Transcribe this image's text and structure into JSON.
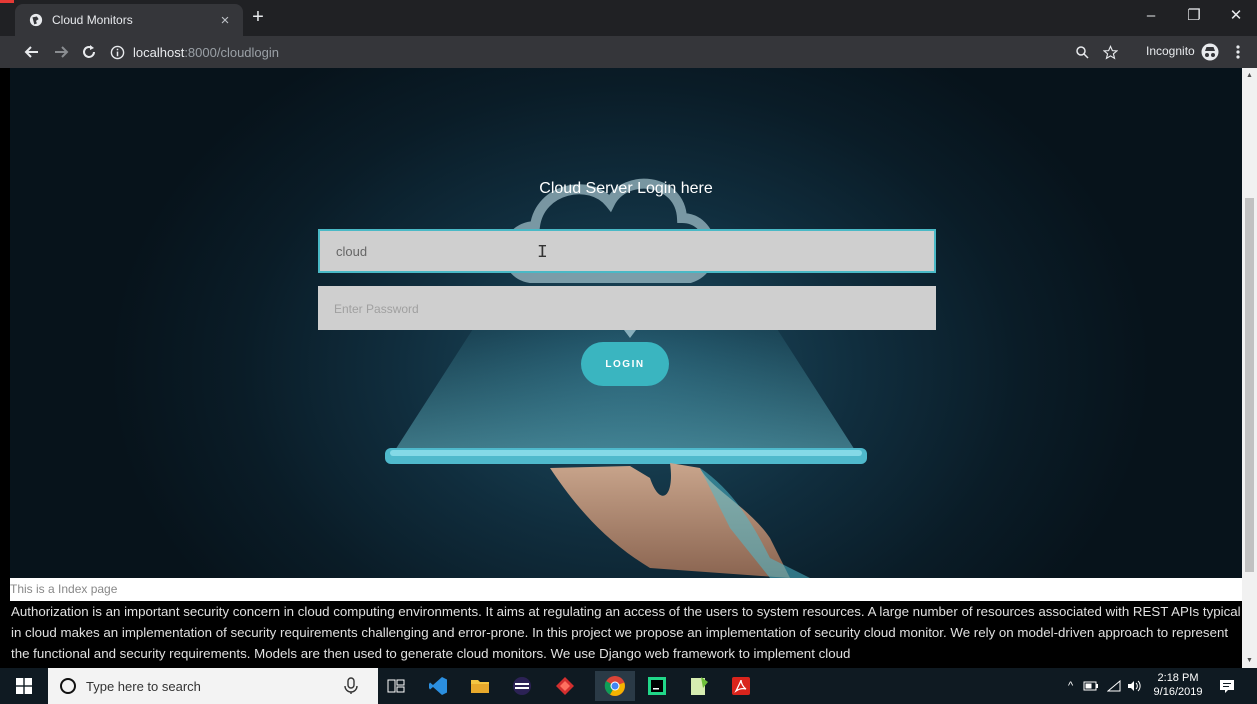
{
  "browser": {
    "tab_title": "Cloud Monitors",
    "tab_close": "×",
    "new_tab": "+",
    "url_host": "localhost",
    "url_path": ":8000/cloudlogin",
    "incognito_label": "Incognito",
    "win_minimize": "–",
    "win_restore": "❐",
    "win_close": "✕"
  },
  "login": {
    "title": "Cloud Server Login here",
    "username_value": "cloud",
    "password_placeholder": "Enter Password",
    "button_label": "LOGIN"
  },
  "page": {
    "index_note": "This is a Index page",
    "description": "Authorization is an important security concern in cloud computing environments. It aims at regulating an access of the users to system resources. A large number of resources associated with REST APIs typical in cloud makes an implementation of security requirements challenging and error-prone. In this project we propose an implementation of security cloud monitor. We rely on model-driven approach to represent the functional and security requirements. Models are then used to generate cloud monitors. We use Django web framework to implement cloud"
  },
  "taskbar": {
    "search_placeholder": "Type here to search",
    "time": "2:18 PM",
    "date": "9/16/2019"
  },
  "colors": {
    "accent": "#3ab5c0",
    "chrome_dark": "#202124",
    "chrome_toolbar": "#35363a",
    "taskbar": "#0f1a22"
  }
}
